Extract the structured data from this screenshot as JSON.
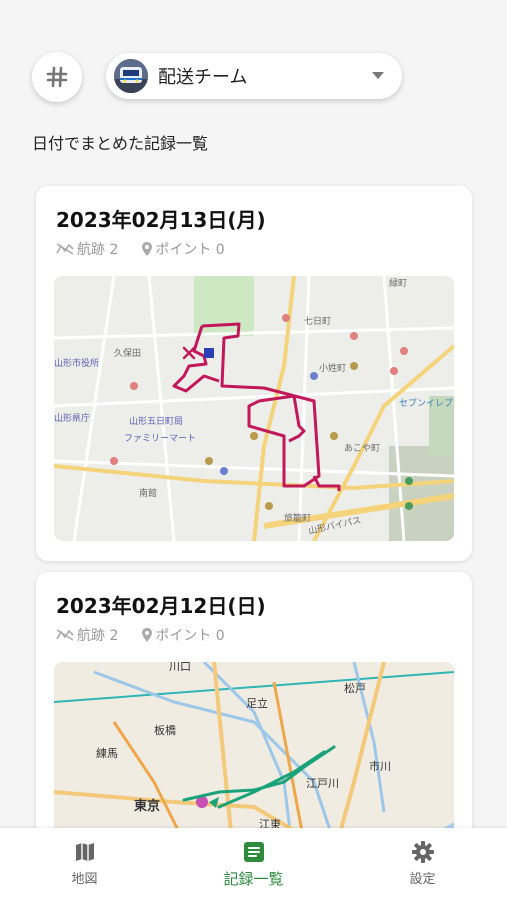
{
  "header": {
    "hash_icon": "hash-icon",
    "team": {
      "name": "配送チーム",
      "avatar_icon": "train-avatar-icon",
      "dropdown_icon": "caret-down-icon"
    }
  },
  "section_title": "日付でまとめた記録一覧",
  "records": [
    {
      "date": "2023年02月13日(月)",
      "tracks_label": "航跡 2",
      "points_label": "ポイント 0",
      "route_color": "#c2185b",
      "map_labels": {
        "a": "七日町",
        "b": "小姓町",
        "c": "山形五日町局",
        "d": "山形市役所",
        "e": "ファミリーマート",
        "f": "山形県庁",
        "g": "旅籠町",
        "h": "久保田",
        "i": "南館",
        "j": "あこや町",
        "k": "緑町",
        "l": "山形バイパス",
        "m": "セブンイレブン"
      }
    },
    {
      "date": "2023年02月12日(日)",
      "tracks_label": "航跡 2",
      "points_label": "ポイント 0",
      "route_color": "#1aa37a",
      "map_labels": {
        "a": "川口",
        "b": "足立",
        "c": "松戸",
        "d": "練馬",
        "e": "江戸川",
        "f": "東京",
        "g": "江東",
        "h": "市川",
        "i": "板橋"
      }
    }
  ],
  "nav": {
    "items": [
      {
        "label": "地図",
        "icon": "map-icon",
        "active": false
      },
      {
        "label": "記録一覧",
        "icon": "list-icon",
        "active": true
      },
      {
        "label": "設定",
        "icon": "gear-icon",
        "active": false
      }
    ],
    "active_color": "#2e8b3e"
  }
}
